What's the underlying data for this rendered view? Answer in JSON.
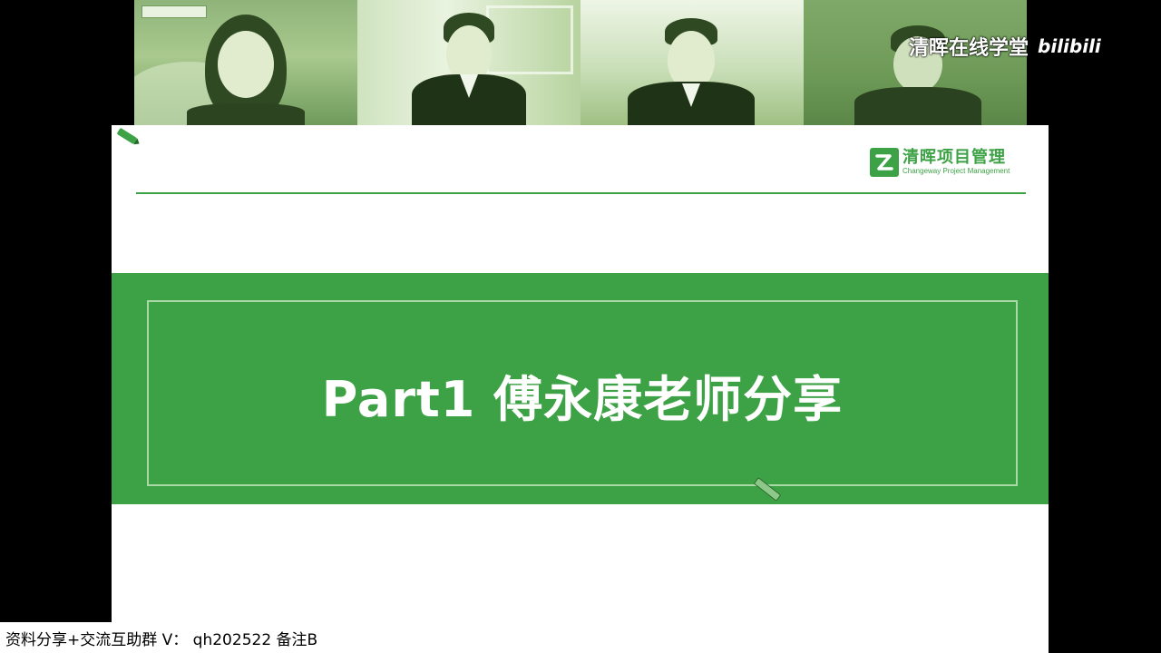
{
  "watermark": {
    "channel": "清晖在线学堂",
    "platform": "bilibili"
  },
  "participants": [
    {
      "label": "participant 1"
    },
    {
      "label": "participant 2"
    },
    {
      "label": "participant 3"
    },
    {
      "label": "participant 4"
    }
  ],
  "slide": {
    "brand_cn": "清晖项目管理",
    "brand_en": "Changeway Project Management",
    "title": "Part1 傅永康老师分享"
  },
  "caption": {
    "text": "资料分享+交流互助群 V： qh202522 备注B"
  },
  "colors": {
    "accent_green": "#3da245",
    "frame_light_green": "#a8d9a6",
    "background": "#000000"
  },
  "icons": [
    "pencil-icon",
    "brand-logo-icon"
  ]
}
